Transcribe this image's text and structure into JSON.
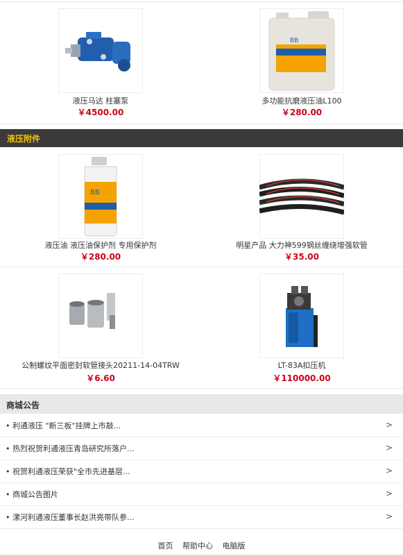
{
  "products_top": [
    {
      "name": "液压马达 柱塞泵",
      "price": "￥4500.00",
      "image": "hydraulic-pump-image"
    },
    {
      "name": "多功能抗磨液压油L100",
      "price": "￥280.00",
      "image": "oil-drum-image"
    }
  ],
  "category": {
    "title": "液压附件"
  },
  "products_accessories": [
    {
      "name": "液压油 液压油保护剂 专用保护剂",
      "price": "￥280.00",
      "image": "oil-bottle-image"
    },
    {
      "name": "明星产品 大力神599钢丝缠绕增强软管",
      "price": "￥35.00",
      "image": "hose-image"
    },
    {
      "name": "公制螺纹平面密封软管接头20211-14-04TRW",
      "price": "￥6.60",
      "image": "hose-fitting-image"
    },
    {
      "name": "LT-83A扣压机",
      "price": "￥110000.00",
      "image": "crimping-machine-image"
    }
  ],
  "notices": {
    "title": "商城公告",
    "items": [
      "利通液压 \"新三板\"挂牌上市敲...",
      "热烈祝贺利通液压青岛研究所落户...",
      "祝贺利通液压荣获\"全市先进基层...",
      "商城公告图片",
      "漯河利通液压董事长赵洪亮带队参..."
    ]
  },
  "footer": {
    "home": "首页",
    "help": "帮助中心",
    "pc": "电脑版"
  },
  "colors": {
    "price": "#d0021b",
    "category_bg": "#3a3a3a",
    "category_text": "#f5c400"
  }
}
